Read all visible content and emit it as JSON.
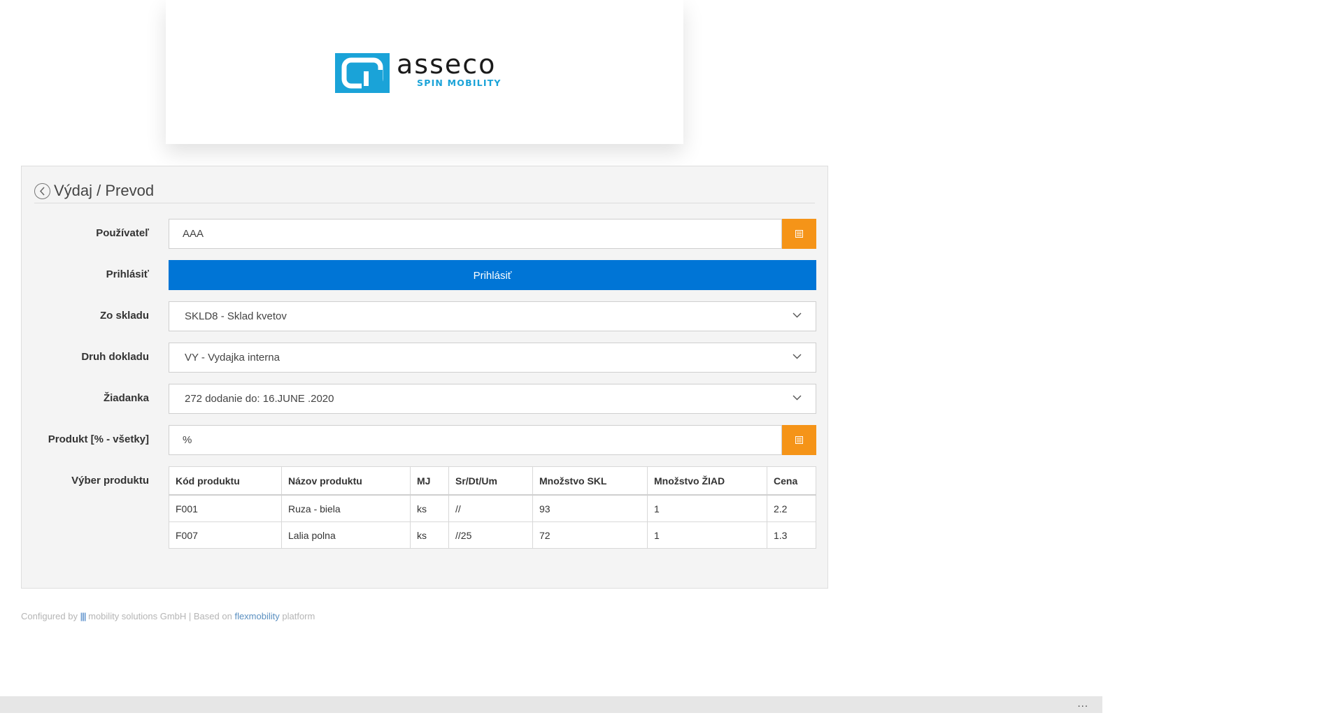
{
  "logo": {
    "wordmark": "asseco",
    "subtitle": "SPIN MOBILITY",
    "brand_color": "#1aa3d8"
  },
  "panel": {
    "title": "Výdaj / Prevod"
  },
  "form": {
    "user": {
      "label": "Používateľ",
      "value": "AAA"
    },
    "login": {
      "label": "Prihlásiť",
      "button_label": "Prihlásiť"
    },
    "warehouse": {
      "label": "Zo skladu",
      "selected": "SKLD8 - Sklad kvetov"
    },
    "doc_type": {
      "label": "Druh dokladu",
      "selected": "VY - Vydajka interna"
    },
    "request": {
      "label": "Žiadanka",
      "selected": "272 dodanie do: 16.JUNE .2020"
    },
    "product": {
      "label": "Produkt [% - všetky]",
      "value": "%"
    },
    "product_selection": {
      "label": "Výber produktu"
    }
  },
  "table": {
    "columns": [
      "Kód produktu",
      "Názov produktu",
      "MJ",
      "Sr/Dt/Um",
      "Množstvo SKL",
      "Množstvo ŽIAD",
      "Cena"
    ],
    "rows": [
      [
        "F001",
        "Ruza - biela",
        "ks",
        "//",
        "93",
        "1",
        "2.2"
      ],
      [
        "F007",
        "Lalia polna",
        "ks",
        "//25",
        "72",
        "1",
        "1.3"
      ]
    ]
  },
  "footer": {
    "prefix": "Configured by",
    "bars": "|||",
    "company": "mobility solutions GmbH | Based on",
    "link": "flexmobility",
    "suffix": "platform"
  },
  "bottom_bar": {
    "more": "..."
  },
  "colors": {
    "accent_orange": "#f59418",
    "primary_blue": "#0075d6",
    "panel_bg": "#f4f4f4"
  }
}
